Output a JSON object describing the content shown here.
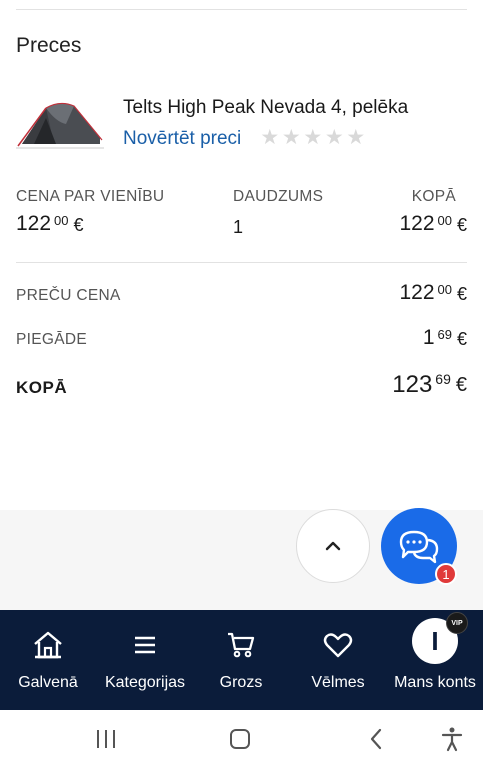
{
  "section": {
    "title": "Preces"
  },
  "product": {
    "name": "Telts High Peak Nevada 4, pelēka",
    "rate_link": "Novērtēt preci",
    "rating": {
      "filled": 0,
      "max": 5
    },
    "image_icon": "tent-image"
  },
  "columns": {
    "unit_price_label": "CENA PAR VIENĪBU",
    "quantity_label": "DAUDZUMS",
    "total_label": "KOPĀ",
    "unit_price": {
      "main": "122",
      "cents": "00",
      "currency": "€"
    },
    "quantity": "1",
    "total": {
      "main": "122",
      "cents": "00",
      "currency": "€"
    }
  },
  "summary": {
    "items_price_label": "PREČU CENA",
    "items_price": {
      "main": "122",
      "cents": "00",
      "currency": "€"
    },
    "delivery_label": "PIEGĀDE",
    "delivery": {
      "main": "1",
      "cents": "69",
      "currency": "€"
    },
    "grand_total_label": "KOPĀ",
    "grand_total": {
      "main": "123",
      "cents": "69",
      "currency": "€"
    }
  },
  "floating": {
    "scroll_top_icon": "chevron-up-icon",
    "chat_icon": "chat-bubbles-icon",
    "chat_badge": "1"
  },
  "nav": {
    "items": [
      {
        "label": "Galvenā",
        "icon": "home-icon"
      },
      {
        "label": "Kategorijas",
        "icon": "menu-icon"
      },
      {
        "label": "Grozs",
        "icon": "cart-icon"
      },
      {
        "label": "Vēlmes",
        "icon": "heart-icon"
      },
      {
        "label": "Mans konts",
        "icon": "avatar",
        "avatar_letter": "I",
        "badge": "VIP"
      }
    ]
  },
  "system_nav": {
    "recents": "recents-icon",
    "home": "home-square-icon",
    "back": "back-icon",
    "accessibility": "accessibility-icon"
  },
  "colors": {
    "nav_bg": "#0b1c3a",
    "link": "#1a5fa8",
    "chat_button": "#1a6be8",
    "badge": "#e03a3a"
  }
}
